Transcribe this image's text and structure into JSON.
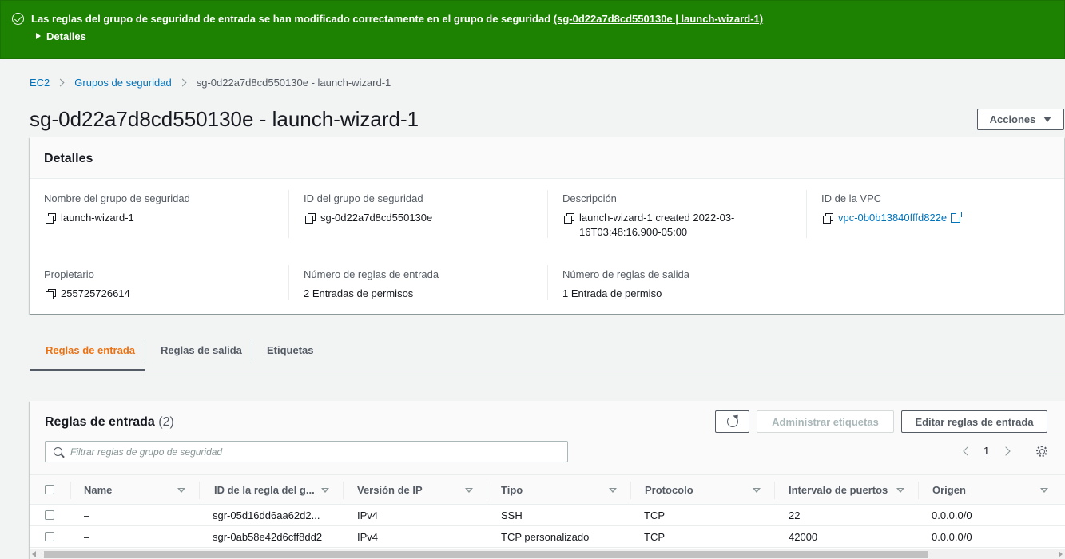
{
  "colors": {
    "success": "#1d8102",
    "link": "#0073bb",
    "active_tab": "#ec7211",
    "text": "#16191f",
    "muted": "#545b64"
  },
  "flash": {
    "icon": "check-circle-icon",
    "message": "Las reglas del grupo de seguridad de entrada se han modificado correctamente en el grupo de seguridad ",
    "link_text": "(sg-0d22a7d8cd550130e | launch-wizard-1)",
    "details_label": "Detalles"
  },
  "breadcrumb": {
    "items": [
      "EC2",
      "Grupos de seguridad"
    ],
    "current": "sg-0d22a7d8cd550130e - launch-wizard-1"
  },
  "header": {
    "title": "sg-0d22a7d8cd550130e - launch-wizard-1",
    "actions_label": "Acciones"
  },
  "details": {
    "title": "Detalles",
    "fields": {
      "name": {
        "label": "Nombre del grupo de seguridad",
        "value": "launch-wizard-1"
      },
      "id": {
        "label": "ID del grupo de seguridad",
        "value": "sg-0d22a7d8cd550130e"
      },
      "description": {
        "label": "Descripción",
        "value_line1": "launch-wizard-1 created 2022-03-",
        "value_line2": "16T03:48:16.900-05:00"
      },
      "vpc": {
        "label": "ID de la VPC",
        "value": "vpc-0b0b13840fffd822e"
      },
      "owner": {
        "label": "Propietario",
        "value": "255725726614"
      },
      "inbound_count": {
        "label": "Número de reglas de entrada",
        "value": "2 Entradas de permisos"
      },
      "outbound_count": {
        "label": "Número de reglas de salida",
        "value": "1 Entrada de permiso"
      }
    }
  },
  "tabs": [
    "Reglas de entrada",
    "Reglas de salida",
    "Etiquetas"
  ],
  "rules": {
    "title": "Reglas de entrada",
    "count": "(2)",
    "manage_tags_label": "Administrar etiquetas",
    "edit_label": "Editar reglas de entrada",
    "filter_placeholder": "Filtrar reglas de grupo de seguridad",
    "page": "1",
    "columns": [
      "Name",
      "ID de la regla del g...",
      "Versión de IP",
      "Tipo",
      "Protocolo",
      "Intervalo de puertos",
      "Origen"
    ],
    "rows": [
      [
        "–",
        "sgr-05d16dd6aa62d2...",
        "IPv4",
        "SSH",
        "TCP",
        "22",
        "0.0.0.0/0"
      ],
      [
        "–",
        "sgr-0ab58e42d6cff8dd2",
        "IPv4",
        "TCP personalizado",
        "TCP",
        "42000",
        "0.0.0.0/0"
      ]
    ]
  }
}
